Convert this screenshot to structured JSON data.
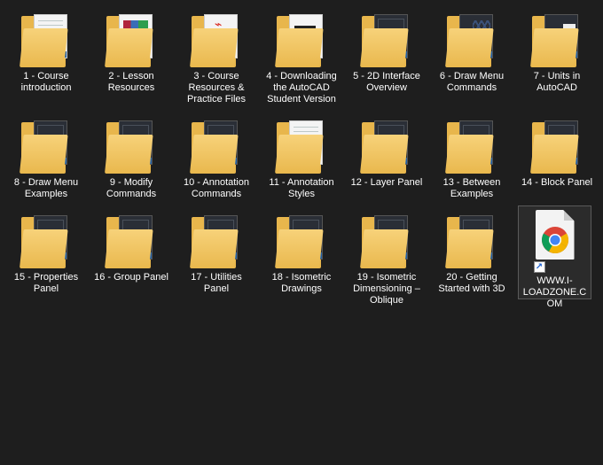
{
  "items": [
    {
      "label": "1 - Course introduction",
      "icon": "folder-icon",
      "thumb": "light-doc"
    },
    {
      "label": "2 - Lesson Resources",
      "icon": "folder-icon",
      "thumb": "winrar"
    },
    {
      "label": "3 - Course Resources & Practice Files",
      "icon": "folder-icon",
      "thumb": "pdf"
    },
    {
      "label": "4 - Downloading the AutoCAD Student Version",
      "icon": "folder-icon",
      "thumb": "autocad-download"
    },
    {
      "label": "5 - 2D Interface Overview",
      "icon": "folder-icon",
      "thumb": "dark"
    },
    {
      "label": "6 - Draw Menu Commands",
      "icon": "folder-icon",
      "thumb": "hex"
    },
    {
      "label": "7 - Units in AutoCAD",
      "icon": "folder-icon",
      "thumb": "dark-white-panel"
    },
    {
      "label": "8 - Draw Menu Examples",
      "icon": "folder-icon",
      "thumb": "dark"
    },
    {
      "label": "9 - Modify Commands",
      "icon": "folder-icon",
      "thumb": "dark"
    },
    {
      "label": "10 - Annotation Commands",
      "icon": "folder-icon",
      "thumb": "dark"
    },
    {
      "label": "11 - Annotation Styles",
      "icon": "folder-icon",
      "thumb": "light-doc"
    },
    {
      "label": "12 - Layer Panel",
      "icon": "folder-icon",
      "thumb": "dark"
    },
    {
      "label": "13 - Between Examples",
      "icon": "folder-icon",
      "thumb": "dark"
    },
    {
      "label": "14 - Block Panel",
      "icon": "folder-icon",
      "thumb": "dark"
    },
    {
      "label": "15 - Properties Panel",
      "icon": "folder-icon",
      "thumb": "dark"
    },
    {
      "label": "16 - Group Panel",
      "icon": "folder-icon",
      "thumb": "dark"
    },
    {
      "label": "17 - Utilities Panel",
      "icon": "folder-icon",
      "thumb": "dark"
    },
    {
      "label": "18 - Isometric Drawings",
      "icon": "folder-icon",
      "thumb": "dark"
    },
    {
      "label": "19 - Isometric Dimensioning – Oblique",
      "icon": "folder-icon",
      "thumb": "dark"
    },
    {
      "label": "20 - Getting Started with 3D",
      "icon": "folder-icon",
      "thumb": "dark"
    }
  ],
  "shortcut": {
    "label": "WWW.I-LOADZONE.COM",
    "icon": "chrome-icon",
    "overlay": "shortcut-arrow-icon",
    "overlay_glyph": "↗"
  },
  "colors": {
    "background": "#1e1e1e",
    "folder": "#e8b64c",
    "label_text": "#ffffff"
  }
}
